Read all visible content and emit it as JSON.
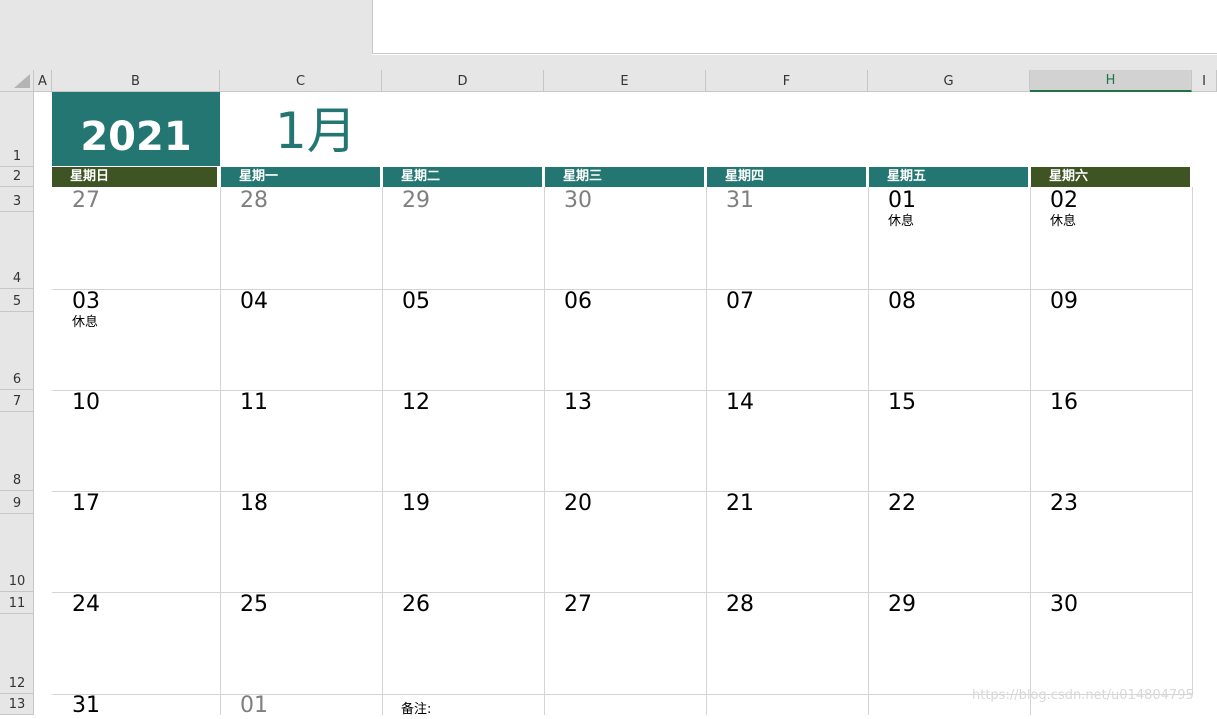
{
  "columns": [
    "A",
    "B",
    "C",
    "D",
    "E",
    "F",
    "G",
    "H",
    "I"
  ],
  "selected_column": "H",
  "rows": [
    "1",
    "2",
    "3",
    "4",
    "5",
    "6",
    "7",
    "8",
    "9",
    "10",
    "11",
    "12",
    "13"
  ],
  "calendar": {
    "year": "2021",
    "month": "1月",
    "weekdays": [
      "星期日",
      "星期一",
      "星期二",
      "星期三",
      "星期四",
      "星期五",
      "星期六"
    ],
    "weeks": [
      [
        {
          "d": "27",
          "m": true
        },
        {
          "d": "28",
          "m": true
        },
        {
          "d": "29",
          "m": true
        },
        {
          "d": "30",
          "m": true
        },
        {
          "d": "31",
          "m": true
        },
        {
          "d": "01",
          "n": "休息"
        },
        {
          "d": "02",
          "n": "休息"
        }
      ],
      [
        {
          "d": "03",
          "n": "休息"
        },
        {
          "d": "04"
        },
        {
          "d": "05"
        },
        {
          "d": "06"
        },
        {
          "d": "07"
        },
        {
          "d": "08"
        },
        {
          "d": "09"
        }
      ],
      [
        {
          "d": "10"
        },
        {
          "d": "11"
        },
        {
          "d": "12"
        },
        {
          "d": "13"
        },
        {
          "d": "14"
        },
        {
          "d": "15"
        },
        {
          "d": "16"
        }
      ],
      [
        {
          "d": "17"
        },
        {
          "d": "18"
        },
        {
          "d": "19"
        },
        {
          "d": "20"
        },
        {
          "d": "21"
        },
        {
          "d": "22"
        },
        {
          "d": "23"
        }
      ],
      [
        {
          "d": "24"
        },
        {
          "d": "25"
        },
        {
          "d": "26"
        },
        {
          "d": "27"
        },
        {
          "d": "28"
        },
        {
          "d": "29"
        },
        {
          "d": "30"
        }
      ],
      [
        {
          "d": "31"
        },
        {
          "d": "01",
          "m": true
        }
      ]
    ],
    "memo_label": "备注:"
  },
  "watermark": "https://blog.csdn.net/u014804795",
  "colors": {
    "teal": "#237671",
    "olive": "#3e5423",
    "grid": "#d4d4d4",
    "muted_day": "#7f7f7f"
  }
}
